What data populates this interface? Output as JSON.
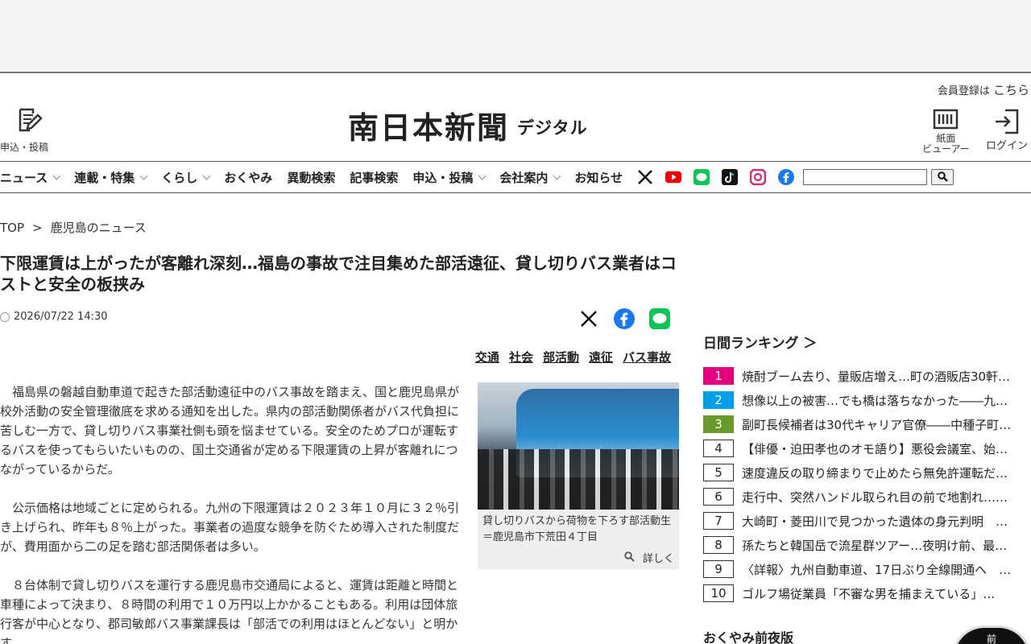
{
  "header": {
    "member_prefix": "会員登録は",
    "member_link": "こちら",
    "submit_label": "申込・投稿",
    "logo_main": "南日本新聞",
    "logo_sub": "デジタル",
    "viewer_label_1": "紙面",
    "viewer_label_2": "ビューアー",
    "login_label": "ログイン"
  },
  "nav": {
    "items": [
      {
        "label": "ニュース",
        "dropdown": true
      },
      {
        "label": "連載・特集",
        "dropdown": true
      },
      {
        "label": "くらし",
        "dropdown": true
      },
      {
        "label": "おくやみ",
        "dropdown": false
      },
      {
        "label": "異動検索",
        "dropdown": false
      },
      {
        "label": "記事検索",
        "dropdown": false
      },
      {
        "label": "申込・投稿",
        "dropdown": true
      },
      {
        "label": "会社案内",
        "dropdown": true
      },
      {
        "label": "お知らせ",
        "dropdown": false
      }
    ],
    "social_icons": [
      "x-icon",
      "youtube-icon",
      "line-icon",
      "tiktok-icon",
      "instagram-icon",
      "facebook-icon"
    ]
  },
  "breadcrumb": {
    "top": "TOP",
    "sep": ">",
    "current": "鹿児島のニュース"
  },
  "article": {
    "headline": "下限運賃は上がったが客離れ深刻…福島の事故で注目集めた部活遠征、貸し切りバス業者はコストと安全の板挟み",
    "date": "2026/07/22 14:30",
    "tags": [
      "交通",
      "社会",
      "部活動",
      "遠征",
      "バス事故"
    ],
    "paragraphs": [
      "福島県の磐越自動車道で起きた部活動遠征中のバス事故を踏まえ、国と鹿児島県が校外活動の安全管理徹底を求める通知を出した。県内の部活動関係者がバス代負担に苦しむ一方で、貸し切りバス事業社側も頭を悩ませている。安全のためプロが運転するバスを使ってもらいたいものの、国土交通省が定める下限運賃の上昇が客離れにつながっているからだ。",
      "公示価格は地域ごとに定められる。九州の下限運賃は２０２３年１０月に３２％引き上げられ、昨年も８％上がった。事業者の過度な競争を防ぐため導入された制度だが、費用面から二の足を踏む部活関係者は多い。",
      "８台体制で貸し切りバスを運行する鹿児島市交通局によると、運賃は距離と時間と車種によって決まり、８時間の利用で１０万円以上かかることもある。利用は団体旅行客が中心となり、郡司敏郎バス事業課長は「部活での利用はほとんどない」と明かす。"
    ],
    "photo_caption": "貸し切りバスから荷物を下ろす部活動生＝鹿児島市下荒田４丁目",
    "photo_more": "詳しく"
  },
  "sidebar": {
    "ranking_title": "日間ランキング ＞",
    "ranking": [
      {
        "num": "1",
        "text": "焼酎ブーム去り、量販店増え…町の酒販店30軒…"
      },
      {
        "num": "2",
        "text": "想像以上の被害…でも橋は落ちなかった――九…"
      },
      {
        "num": "3",
        "text": "副町長候補者は30代キャリア官僚――中種子町…"
      },
      {
        "num": "4",
        "text": "【俳優・迫田孝也のオモ語り】悪役会議室、始…"
      },
      {
        "num": "5",
        "text": "速度違反の取り締まりで止めたら無免許運転だ…"
      },
      {
        "num": "6",
        "text": "走行中、突然ハンドル取られ目の前で地割れ……"
      },
      {
        "num": "7",
        "text": "大崎町・菱田川で見つかった遺体の身元判明　…"
      },
      {
        "num": "8",
        "text": "孫たちと韓国岳で流星群ツアー…夜明け前、最…"
      },
      {
        "num": "9",
        "text": "〈詳報〉九州自動車道、17日ぶり全線開通へ　…"
      },
      {
        "num": "10",
        "text": "ゴルフ場従業員「不審な男を捕まえている」…"
      }
    ],
    "okuyami_title": "おくやみ前夜版",
    "thumb_text": "前"
  }
}
